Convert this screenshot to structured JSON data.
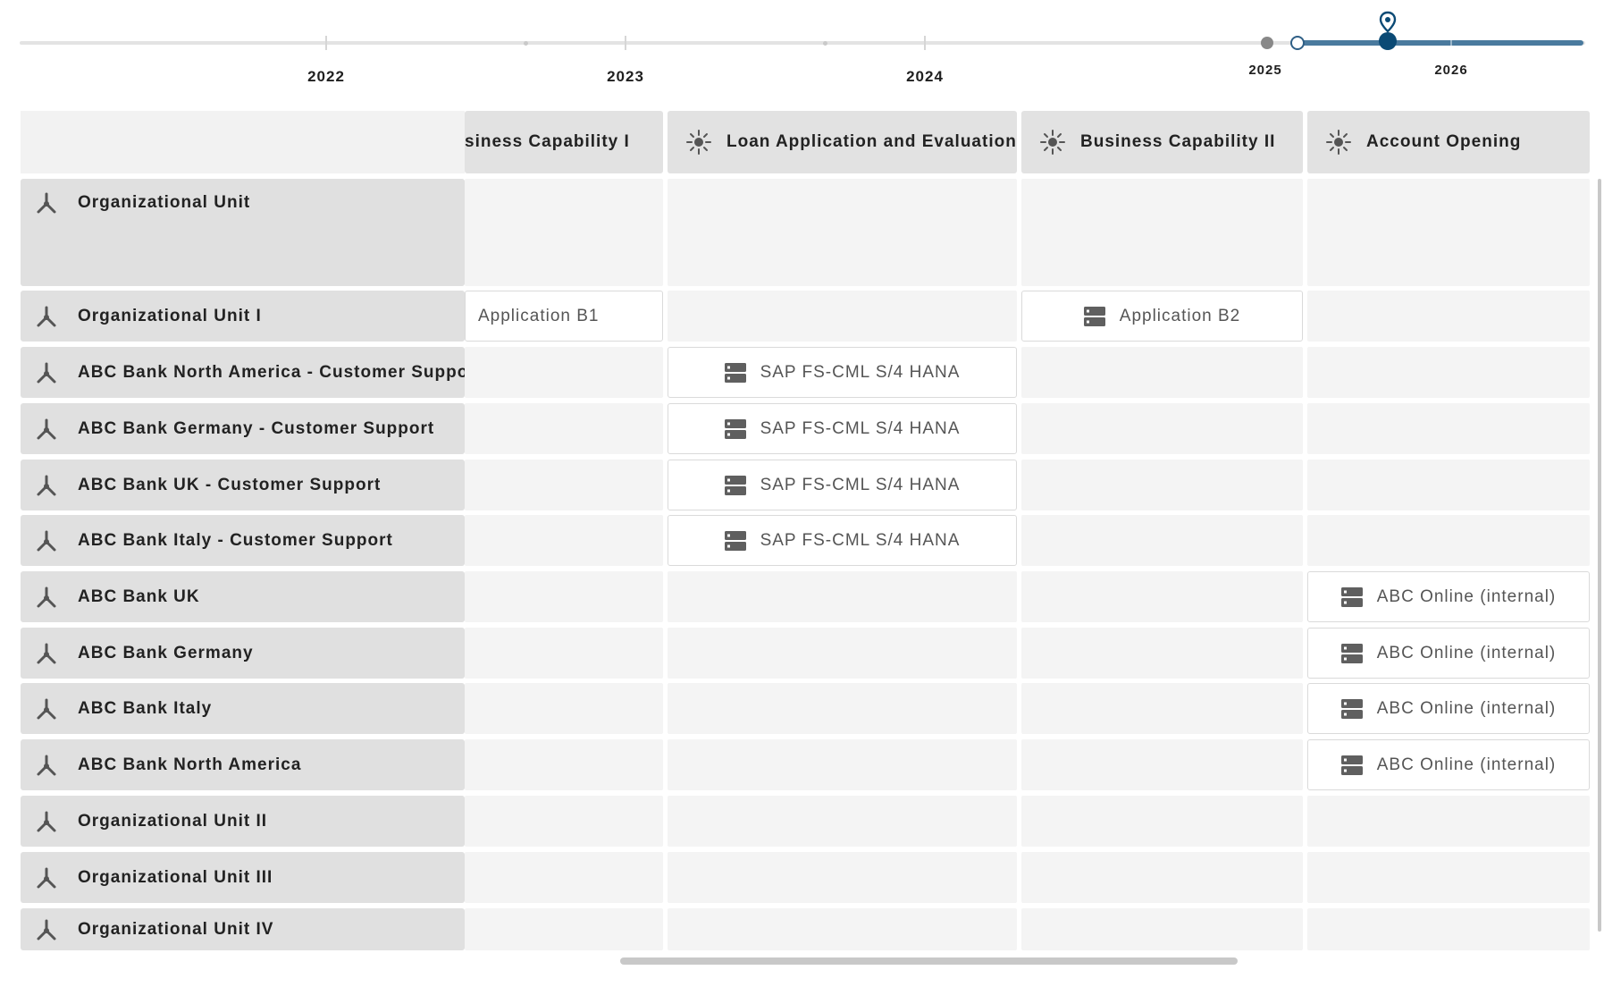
{
  "timeline": {
    "years": [
      "2022",
      "2023",
      "2024",
      "2025",
      "2026"
    ],
    "selected_year": "2025"
  },
  "columns": [
    {
      "label": "siness Capability I",
      "icon": "capability-icon"
    },
    {
      "label": "Loan Application and Evaluation",
      "icon": "capability-icon"
    },
    {
      "label": "Business Capability II",
      "icon": "capability-icon"
    },
    {
      "label": "Account Opening",
      "icon": "capability-icon"
    }
  ],
  "rows": [
    {
      "label": "Organizational Unit",
      "icon": "org-unit-icon",
      "cells": [
        "",
        "",
        "",
        ""
      ]
    },
    {
      "label": "Organizational Unit I",
      "icon": "org-unit-icon",
      "cells": [
        "Application B1",
        "",
        "Application B2",
        ""
      ]
    },
    {
      "label": "ABC Bank North America - Customer Support",
      "icon": "org-unit-icon",
      "cells": [
        "",
        "SAP FS-CML S/4 HANA",
        "",
        ""
      ]
    },
    {
      "label": "ABC Bank Germany - Customer Support",
      "icon": "org-unit-icon",
      "cells": [
        "",
        "SAP FS-CML S/4 HANA",
        "",
        ""
      ]
    },
    {
      "label": "ABC Bank UK - Customer Support",
      "icon": "org-unit-icon",
      "cells": [
        "",
        "SAP FS-CML S/4 HANA",
        "",
        ""
      ]
    },
    {
      "label": "ABC Bank Italy - Customer Support",
      "icon": "org-unit-icon",
      "cells": [
        "",
        "SAP FS-CML S/4 HANA",
        "",
        ""
      ]
    },
    {
      "label": "ABC Bank UK",
      "icon": "org-unit-icon",
      "cells": [
        "",
        "",
        "",
        "ABC Online (internal)"
      ]
    },
    {
      "label": "ABC Bank Germany",
      "icon": "org-unit-icon",
      "cells": [
        "",
        "",
        "",
        "ABC Online (internal)"
      ]
    },
    {
      "label": "ABC Bank Italy",
      "icon": "org-unit-icon",
      "cells": [
        "",
        "",
        "",
        "ABC Online (internal)"
      ]
    },
    {
      "label": "ABC Bank North America",
      "icon": "org-unit-icon",
      "cells": [
        "",
        "",
        "",
        "ABC Online (internal)"
      ]
    },
    {
      "label": "Organizational Unit II",
      "icon": "org-unit-icon",
      "cells": [
        "",
        "",
        "",
        ""
      ]
    },
    {
      "label": "Organizational Unit III",
      "icon": "org-unit-icon",
      "cells": [
        "",
        "",
        "",
        ""
      ]
    },
    {
      "label": "Organizational Unit IV",
      "icon": "org-unit-icon",
      "cells": [
        "",
        "",
        "",
        ""
      ]
    }
  ],
  "colors": {
    "timeline_range": "#4a7a9e",
    "timeline_handle": "#0b4a75",
    "header_bg": "#e2e2e2",
    "cell_bg": "#f4f4f4",
    "icon": "#555555"
  }
}
